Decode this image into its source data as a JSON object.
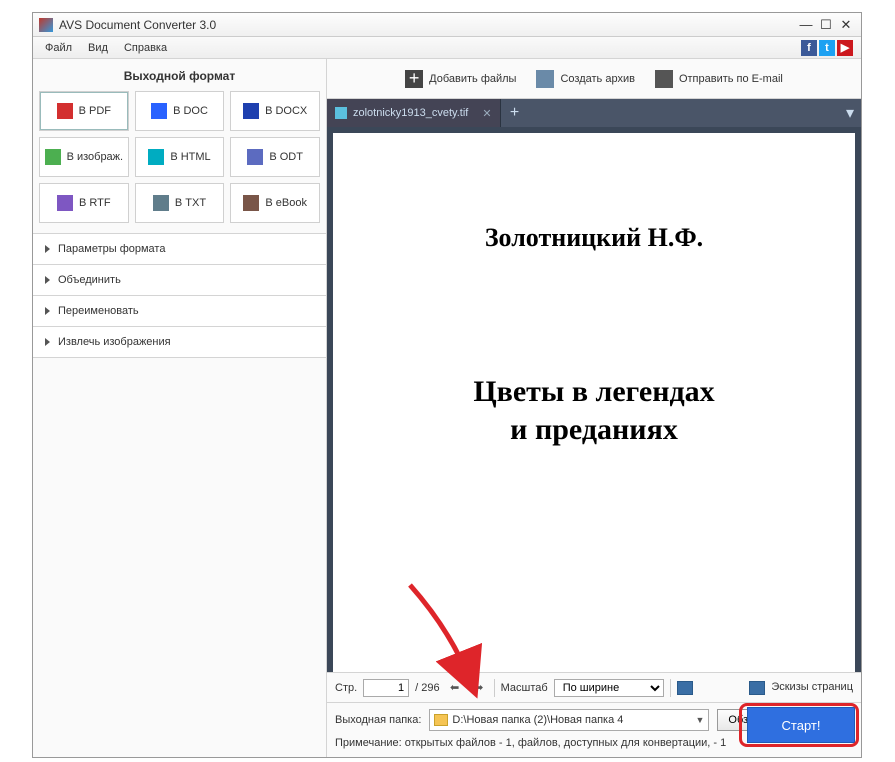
{
  "title": "AVS Document Converter 3.0",
  "menu": {
    "file": "Файл",
    "view": "Вид",
    "help": "Справка"
  },
  "sidebar": {
    "title": "Выходной формат",
    "formats": [
      "В PDF",
      "В DOC",
      "В DOCX",
      "В изображ.",
      "В HTML",
      "В ODT",
      "В RTF",
      "В TXT",
      "В eBook"
    ],
    "accordion": [
      "Параметры формата",
      "Объединить",
      "Переименовать",
      "Извлечь изображения"
    ]
  },
  "toolbar": {
    "add": "Добавить файлы",
    "archive": "Создать архив",
    "email": "Отправить по E-mail"
  },
  "tab": {
    "name": "zolotnicky1913_cvety.tif"
  },
  "document": {
    "author": "Золотницкий Н.Ф.",
    "bookTitle": "Цветы в легендах\nи преданиях"
  },
  "pager": {
    "label": "Стр.",
    "current": "1",
    "total": "/ 296",
    "zoomLabel": "Масштаб",
    "zoomValue": "По ширине",
    "thumbs": "Эскизы страниц"
  },
  "output": {
    "label": "Выходная папка:",
    "path": "D:\\Новая папка (2)\\Новая папка 4",
    "browse": "Обзор...",
    "start": "Старт!"
  },
  "note": "Примечание: открытых файлов - 1, файлов, доступных для конвертации, - 1"
}
